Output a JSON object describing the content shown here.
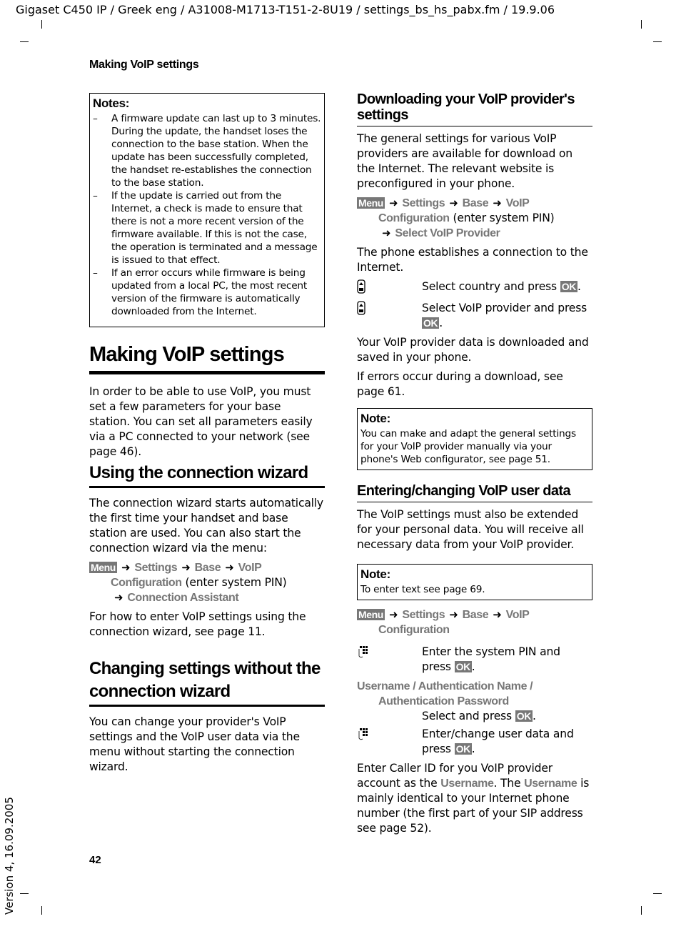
{
  "header": "Gigaset C450 IP / Greek eng / A31008-M1713-T151-2-8U19 / settings_bs_hs_pabx.fm / 19.9.06",
  "running_head": "Making VoIP settings",
  "page_number": "42",
  "version": "Version 4, 16.09.2005",
  "keys": {
    "menu": "Menu",
    "ok": "OK"
  },
  "left": {
    "notes": {
      "title": "Notes:",
      "items": [
        "A firmware update can last up to 3 minutes. During the update, the handset loses the connection to the base station. When the update has been successfully completed, the handset re-establishes the connection to the base station.",
        "If the update is carried out from the Internet, a check is made to ensure that there is not a more recent version of the firmware available. If this is not the case, the operation is terminated and a message is issued to that effect.",
        "If an error occurs while firmware is being updated from a local PC, the most recent version of the firmware is automatically downloaded from the Internet."
      ]
    },
    "h1": "Making VoIP settings",
    "intro": "In order to be able to use VoIP, you must set a few parameters for your base station. You can set all parameters easily via a PC connected to your network (see page 46).",
    "wizard": {
      "heading": "Using the connection wizard",
      "text": "The connection wizard starts automatically the first time your handset and base station are used. You can also start the connection wizard via the menu:",
      "path": [
        "Settings",
        "Base",
        "VoIP",
        "Configuration"
      ],
      "path_note": "(enter system PIN)",
      "path_last": "Connection Assistant",
      "after": "For how to enter VoIP settings using the connection wizard, see page 11."
    },
    "without": {
      "heading": "Changing settings without the connection wizard",
      "text": "You can change your provider's VoIP settings and the VoIP user data via the menu without starting the connection wizard."
    }
  },
  "right": {
    "download": {
      "heading": "Downloading your VoIP provider's settings",
      "text": "The general settings for various VoIP providers are available for download on the Internet. The relevant website is preconfigured in your phone.",
      "path": [
        "Settings",
        "Base",
        "VoIP",
        "Configuration"
      ],
      "path_note": "(enter system PIN)",
      "path_last": "Select VoIP Provider",
      "connect": "The phone establishes a connection to the Internet.",
      "steps": [
        {
          "icon": "navigation-key-icon",
          "text": "Select country and press"
        },
        {
          "icon": "navigation-key-icon",
          "text": "Select VoIP provider and press"
        }
      ],
      "saved": "Your VoIP provider data is downloaded and saved in your phone.",
      "errors": "If errors occur during a download, see page 61.",
      "note": {
        "title": "Note:",
        "text": "You can make and adapt the general settings for your VoIP provider manually via your phone's Web configurator, see page 51."
      }
    },
    "userdata": {
      "heading": "Entering/changing VoIP user data",
      "text": "The VoIP settings must also be extended for your personal data. You will receive all necessary data from your VoIP provider.",
      "note": {
        "title": "Note:",
        "text": "To enter text see page 69."
      },
      "path": [
        "Settings",
        "Base",
        "VoIP",
        "Configuration"
      ],
      "step1": "Enter the system PIN and press",
      "fields_line1": "Username / Authentication Name /",
      "fields_line2": "Authentication Password",
      "step2": "Select and press",
      "step3": "Enter/change user data and press",
      "caller_a": "Enter Caller ID for you VoIP provider account as the ",
      "caller_b": "Username",
      "caller_c": ". The ",
      "caller_d": "Username",
      "caller_e": " is mainly identical to your Internet phone number (the first part of your SIP address see page 52)."
    }
  }
}
